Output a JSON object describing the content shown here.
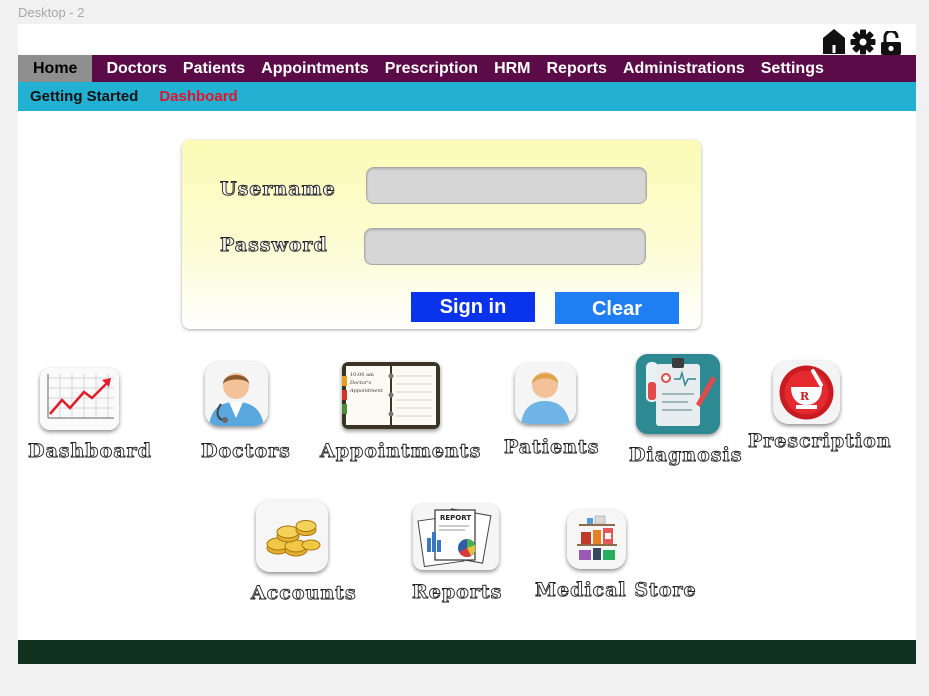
{
  "frame_label": "Desktop - 2",
  "header_icons": [
    "home-icon",
    "gear-icon",
    "unlock-icon"
  ],
  "nav": {
    "items": [
      {
        "label": "Home",
        "active": true
      },
      {
        "label": "Doctors"
      },
      {
        "label": "Patients"
      },
      {
        "label": "Appointments"
      },
      {
        "label": "Prescription"
      },
      {
        "label": "HRM"
      },
      {
        "label": "Reports"
      },
      {
        "label": "Administrations"
      },
      {
        "label": "Settings"
      }
    ]
  },
  "subnav": {
    "items": [
      {
        "label": "Getting Started"
      },
      {
        "label": "Dashboard",
        "active": true
      }
    ]
  },
  "login": {
    "username_label": "Username",
    "password_label": "Password",
    "username_value": "",
    "password_value": "",
    "signin_label": "Sign in",
    "clear_label": "Clear"
  },
  "modules": [
    {
      "label": "Dashboard",
      "icon": "trend-chart-icon"
    },
    {
      "label": "Doctors",
      "icon": "doctor-icon"
    },
    {
      "label": "Appointments",
      "icon": "appointment-book-icon"
    },
    {
      "label": "Patients",
      "icon": "patient-icon"
    },
    {
      "label": "Diagnosis",
      "icon": "clipboard-diagnosis-icon"
    },
    {
      "label": "Prescription",
      "icon": "rx-mortar-icon"
    },
    {
      "label": "Accounts",
      "icon": "coins-icon"
    },
    {
      "label": "Reports",
      "icon": "report-papers-icon"
    },
    {
      "label": "Medical Store",
      "icon": "medicine-shelf-icon"
    }
  ],
  "book_text": {
    "time": "10:00 am",
    "line1": "Doctor's",
    "line2": "Appointment"
  },
  "report_text": "REPORT",
  "colors": {
    "navbar": "#5b0b48",
    "nav_active": "#8e8e8e",
    "subnav": "#23b1d3",
    "subnav_active_text": "#e3142b",
    "signin_button": "#0a33ee",
    "clear_button": "#1f7ef1",
    "footer": "#103120"
  }
}
